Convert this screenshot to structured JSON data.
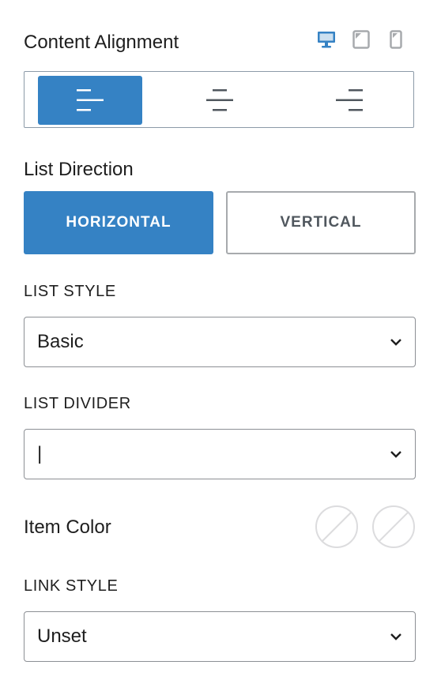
{
  "content_alignment": {
    "title": "Content Alignment",
    "devices": [
      {
        "icon": "desktop-icon",
        "active": true
      },
      {
        "icon": "tablet-icon",
        "active": false
      },
      {
        "icon": "mobile-icon",
        "active": false
      }
    ],
    "options": [
      "left",
      "center",
      "right"
    ],
    "selected": "left"
  },
  "list_direction": {
    "title": "List Direction",
    "horizontal_label": "HORIZONTAL",
    "vertical_label": "VERTICAL",
    "selected": "horizontal"
  },
  "list_style": {
    "label": "LIST STYLE",
    "value": "Basic"
  },
  "list_divider": {
    "label": "LIST DIVIDER",
    "value": "|"
  },
  "item_color": {
    "label": "Item Color",
    "swatches": [
      "unset",
      "unset"
    ]
  },
  "link_style": {
    "label": "LINK STYLE",
    "value": "Unset"
  },
  "colors": {
    "accent": "#3582c4",
    "border": "#8c8f94",
    "text": "#1e1e1e"
  }
}
